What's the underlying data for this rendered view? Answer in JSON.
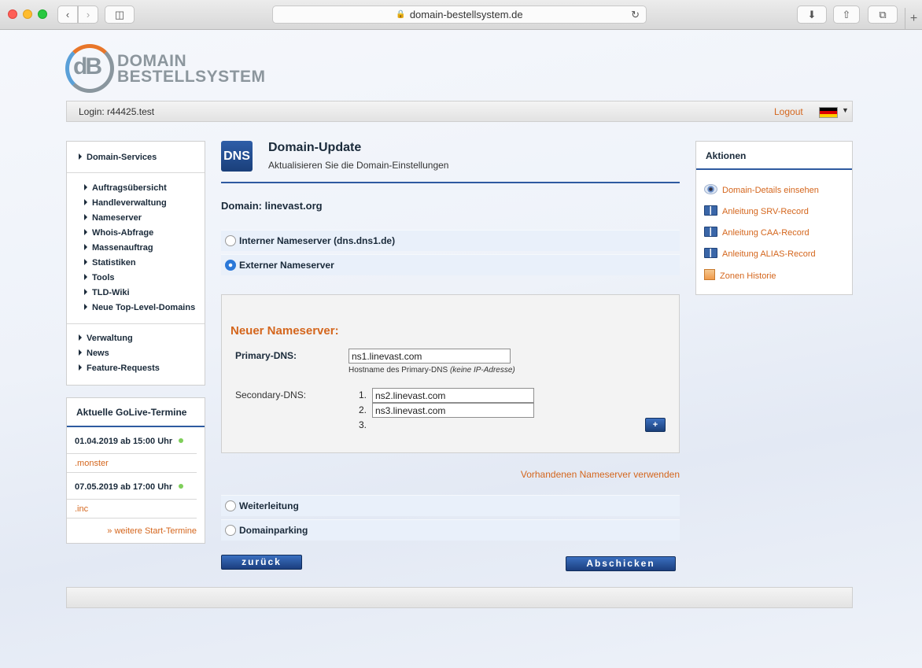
{
  "browser": {
    "url": "domain-bestellsystem.de"
  },
  "logo": {
    "mark": "dB",
    "line1": "DOMAIN",
    "line2": "BESTELLSYSTEM"
  },
  "topbar": {
    "login": "Login: r44425.test",
    "logout": "Logout",
    "language": "de"
  },
  "sidebar": {
    "header": "Domain-Services",
    "items": [
      {
        "label": "Auftragsübersicht"
      },
      {
        "label": "Handleverwaltung"
      },
      {
        "label": "Nameserver"
      },
      {
        "label": "Whois-Abfrage"
      },
      {
        "label": "Massenauftrag"
      },
      {
        "label": "Statistiken"
      },
      {
        "label": "Tools"
      },
      {
        "label": "TLD-Wiki"
      },
      {
        "label": "Neue Top-Level-Domains"
      }
    ],
    "secondary": [
      {
        "label": "Verwaltung"
      },
      {
        "label": "News"
      },
      {
        "label": "Feature-Requests"
      }
    ]
  },
  "golive": {
    "header": "Aktuelle GoLive-Termine",
    "entries": [
      {
        "date": "01.04.2019 ab 15:00 Uhr",
        "tld": ".monster"
      },
      {
        "date": "07.05.2019 ab 17:00 Uhr",
        "tld": ".inc"
      }
    ],
    "more": "» weitere Start-Termine"
  },
  "main": {
    "icon_label": "DNS",
    "title": "Domain-Update",
    "subtitle": "Aktualisieren Sie die Domain-Einstellungen",
    "domain_line": "Domain: linevast.org",
    "options": {
      "internal": "Interner Nameserver (dns.dns1.de)",
      "external": "Externer Nameserver",
      "forward": "Weiterleitung",
      "parking": "Domainparking"
    },
    "nameserver": {
      "title": "Neuer Nameserver:",
      "primary_label": "Primary-DNS:",
      "primary_value": "ns1.linevast.com",
      "primary_hint": "Hostname des Primary-DNS",
      "primary_hint_em": "(keine IP-Adresse)",
      "secondary_label": "Secondary-DNS:",
      "secondary": [
        {
          "num": "1.",
          "value": "ns2.linevast.com"
        },
        {
          "num": "2.",
          "value": "ns3.linevast.com"
        },
        {
          "num": "3.",
          "value": ""
        }
      ],
      "add_label": "+"
    },
    "use_existing": "Vorhandenen Nameserver verwenden",
    "back_label": "zurück",
    "submit_label": "Abschicken"
  },
  "actions": {
    "header": "Aktionen",
    "items": [
      {
        "label": "Domain-Details einsehen",
        "icon": "eye-icon"
      },
      {
        "label": "Anleitung SRV-Record",
        "icon": "book-icon"
      },
      {
        "label": "Anleitung CAA-Record",
        "icon": "book-icon"
      },
      {
        "label": "Anleitung ALIAS-Record",
        "icon": "book-icon"
      },
      {
        "label": "Zonen Historie",
        "icon": "history-icon"
      }
    ]
  },
  "colors": {
    "accent": "#d4661d",
    "brand_blue": "#2e5aa0"
  }
}
